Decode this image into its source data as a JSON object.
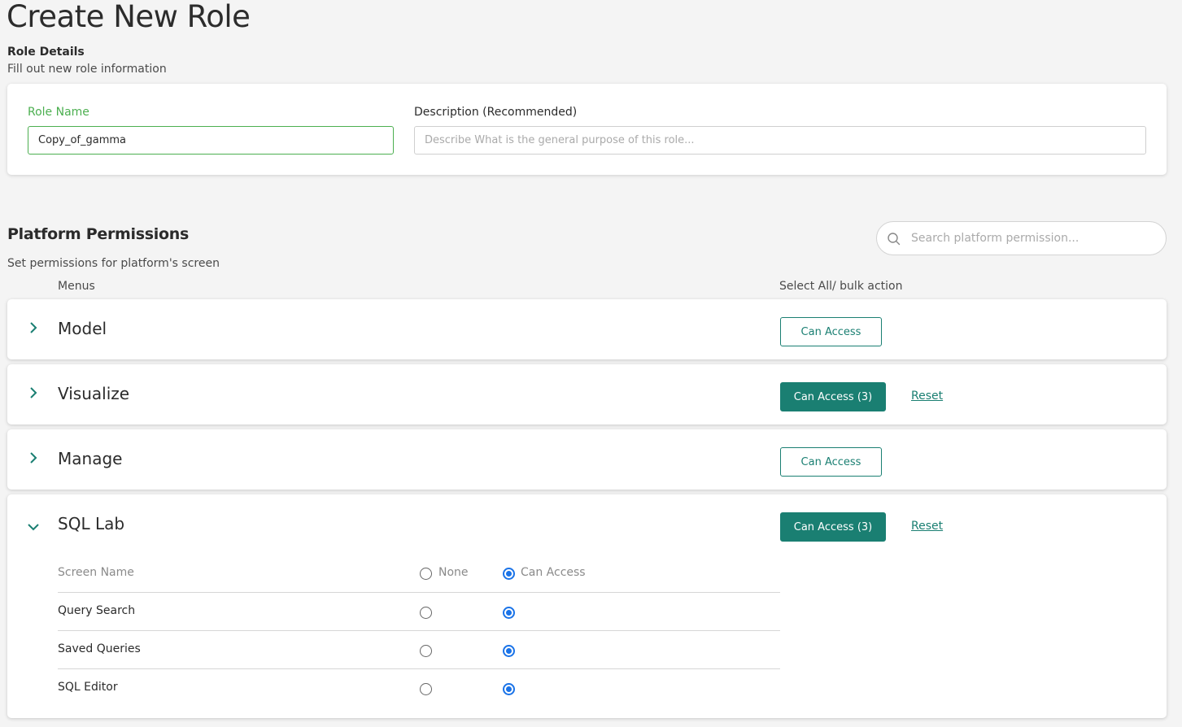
{
  "page": {
    "title": "Create New Role"
  },
  "role_details": {
    "title": "Role Details",
    "subtitle": "Fill out new role information",
    "role_name_label": "Role Name",
    "role_name_value": "Copy_of_gamma",
    "description_label": "Description (Recommended)",
    "description_value": "",
    "description_placeholder": "Describe What is the general purpose of this role..."
  },
  "platform_permissions": {
    "title": "Platform Permissions",
    "subtitle": "Set permissions for platform's screen",
    "search_placeholder": "Search platform permission...",
    "column_menus": "Menus",
    "column_bulk": "Select All/ bulk action",
    "reset_label": "Reset",
    "menus": [
      {
        "name": "Model",
        "expanded": false,
        "button_label": "Can Access",
        "button_style": "outline",
        "show_reset": false
      },
      {
        "name": "Visualize",
        "expanded": false,
        "button_label": "Can Access (3)",
        "button_style": "filled",
        "show_reset": true
      },
      {
        "name": "Manage",
        "expanded": false,
        "button_label": "Can Access",
        "button_style": "outline",
        "show_reset": false
      },
      {
        "name": "SQL Lab",
        "expanded": true,
        "button_label": "Can Access (3)",
        "button_style": "filled",
        "show_reset": true
      }
    ],
    "sql_lab_table": {
      "header_screen_name": "Screen Name",
      "header_none": "None",
      "header_can_access": "Can Access",
      "header_selected": "can_access",
      "rows": [
        {
          "screen": "Query Search",
          "selected": "can_access"
        },
        {
          "screen": "Saved Queries",
          "selected": "can_access"
        },
        {
          "screen": "SQL Editor",
          "selected": "can_access"
        }
      ]
    }
  },
  "colors": {
    "accent_teal": "#1a7f72",
    "valid_green": "#4caf50",
    "radio_blue": "#1a73e8",
    "background": "#f4f4f4"
  }
}
